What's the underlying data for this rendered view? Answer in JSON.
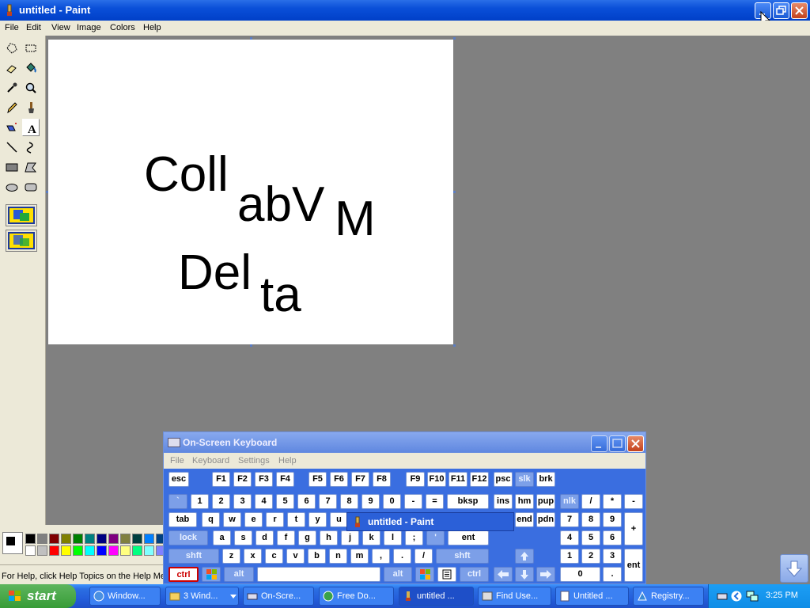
{
  "paint": {
    "title": "untitled - Paint",
    "menu": [
      "File",
      "Edit",
      "View",
      "Image",
      "Colors",
      "Help"
    ],
    "status_text": "For Help, click Help Topics on the Help Menu.",
    "canvas_texts": [
      "Coll",
      "abV",
      "M",
      "Del",
      "ta"
    ],
    "palette_top": [
      "#000000",
      "#808080",
      "#800000",
      "#808000",
      "#008000",
      "#008080",
      "#000080",
      "#800080",
      "#808040",
      "#004040",
      "#0080ff",
      "#004080",
      "#4000ff",
      "#804000"
    ],
    "palette_bottom": [
      "#ffffff",
      "#c0c0c0",
      "#ff0000",
      "#ffff00",
      "#00ff00",
      "#00ffff",
      "#0000ff",
      "#ff00ff",
      "#ffff80",
      "#00ff80",
      "#80ffff",
      "#8080ff",
      "#ff0080",
      "#ff8040"
    ]
  },
  "osk": {
    "title": "On-Screen Keyboard",
    "menu": [
      "File",
      "Keyboard",
      "Settings",
      "Help"
    ],
    "tooltip": "untitled - Paint",
    "keys": {
      "esc": "esc",
      "f1": "F1",
      "f2": "F2",
      "f3": "F3",
      "f4": "F4",
      "f5": "F5",
      "f6": "F6",
      "f7": "F7",
      "f8": "F8",
      "f9": "F9",
      "f10": "F10",
      "f11": "F11",
      "f12": "F12",
      "psc": "psc",
      "slk": "slk",
      "brk": "brk",
      "grave": "`",
      "n1": "1",
      "n2": "2",
      "n3": "3",
      "n4": "4",
      "n5": "5",
      "n6": "6",
      "n7": "7",
      "n8": "8",
      "n9": "9",
      "n0": "0",
      "minus": "-",
      "equals": "=",
      "bksp": "bksp",
      "ins": "ins",
      "hm": "hm",
      "pup": "pup",
      "nlk": "nlk",
      "kp_div": "/",
      "kp_mul": "*",
      "kp_minus": "-",
      "tab": "tab",
      "q": "q",
      "w": "w",
      "e": "e",
      "r": "r",
      "t": "t",
      "y": "y",
      "u": "u",
      "end": "end",
      "pdn": "pdn",
      "kp7": "7",
      "kp8": "8",
      "kp9": "9",
      "kp_plus": "+",
      "lock": "lock",
      "a": "a",
      "s": "s",
      "d": "d",
      "f": "f",
      "g": "g",
      "h": "h",
      "j": "j",
      "k": "k",
      "l": "l",
      "semi": ";",
      "quote": "'",
      "ent": "ent",
      "kp4": "4",
      "kp5": "5",
      "kp6": "6",
      "shft_l": "shft",
      "z": "z",
      "x": "x",
      "c": "c",
      "v": "v",
      "b": "b",
      "n": "n",
      "m": "m",
      "comma": ",",
      "period": ".",
      "slash": "/",
      "shft_r": "shft",
      "kp1": "1",
      "kp2": "2",
      "kp3": "3",
      "kp_ent": "ent",
      "ctrl_l": "ctrl",
      "alt_l": "alt",
      "alt_r": "alt",
      "ctrl_r": "ctrl",
      "kp0": "0",
      "kp_dot": "."
    }
  },
  "taskbar": {
    "start": "start",
    "items": [
      "Window...",
      "3 Wind...",
      "On-Scre...",
      "Free Do...",
      "untitled ...",
      "Find Use...",
      "Untitled ...",
      "Registry..."
    ],
    "clock": "3:25 PM"
  }
}
